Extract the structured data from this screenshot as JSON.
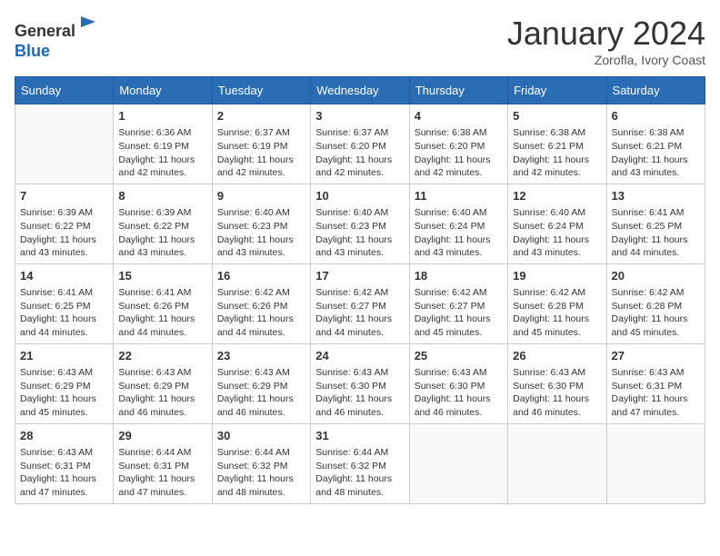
{
  "header": {
    "logo_general": "General",
    "logo_blue": "Blue",
    "month_title": "January 2024",
    "location": "Zorofla, Ivory Coast"
  },
  "days_of_week": [
    "Sunday",
    "Monday",
    "Tuesday",
    "Wednesday",
    "Thursday",
    "Friday",
    "Saturday"
  ],
  "weeks": [
    [
      {
        "day": "",
        "info": ""
      },
      {
        "day": "1",
        "info": "Sunrise: 6:36 AM\nSunset: 6:19 PM\nDaylight: 11 hours\nand 42 minutes."
      },
      {
        "day": "2",
        "info": "Sunrise: 6:37 AM\nSunset: 6:19 PM\nDaylight: 11 hours\nand 42 minutes."
      },
      {
        "day": "3",
        "info": "Sunrise: 6:37 AM\nSunset: 6:20 PM\nDaylight: 11 hours\nand 42 minutes."
      },
      {
        "day": "4",
        "info": "Sunrise: 6:38 AM\nSunset: 6:20 PM\nDaylight: 11 hours\nand 42 minutes."
      },
      {
        "day": "5",
        "info": "Sunrise: 6:38 AM\nSunset: 6:21 PM\nDaylight: 11 hours\nand 42 minutes."
      },
      {
        "day": "6",
        "info": "Sunrise: 6:38 AM\nSunset: 6:21 PM\nDaylight: 11 hours\nand 43 minutes."
      }
    ],
    [
      {
        "day": "7",
        "info": "Sunrise: 6:39 AM\nSunset: 6:22 PM\nDaylight: 11 hours\nand 43 minutes."
      },
      {
        "day": "8",
        "info": "Sunrise: 6:39 AM\nSunset: 6:22 PM\nDaylight: 11 hours\nand 43 minutes."
      },
      {
        "day": "9",
        "info": "Sunrise: 6:40 AM\nSunset: 6:23 PM\nDaylight: 11 hours\nand 43 minutes."
      },
      {
        "day": "10",
        "info": "Sunrise: 6:40 AM\nSunset: 6:23 PM\nDaylight: 11 hours\nand 43 minutes."
      },
      {
        "day": "11",
        "info": "Sunrise: 6:40 AM\nSunset: 6:24 PM\nDaylight: 11 hours\nand 43 minutes."
      },
      {
        "day": "12",
        "info": "Sunrise: 6:40 AM\nSunset: 6:24 PM\nDaylight: 11 hours\nand 43 minutes."
      },
      {
        "day": "13",
        "info": "Sunrise: 6:41 AM\nSunset: 6:25 PM\nDaylight: 11 hours\nand 44 minutes."
      }
    ],
    [
      {
        "day": "14",
        "info": "Sunrise: 6:41 AM\nSunset: 6:25 PM\nDaylight: 11 hours\nand 44 minutes."
      },
      {
        "day": "15",
        "info": "Sunrise: 6:41 AM\nSunset: 6:26 PM\nDaylight: 11 hours\nand 44 minutes."
      },
      {
        "day": "16",
        "info": "Sunrise: 6:42 AM\nSunset: 6:26 PM\nDaylight: 11 hours\nand 44 minutes."
      },
      {
        "day": "17",
        "info": "Sunrise: 6:42 AM\nSunset: 6:27 PM\nDaylight: 11 hours\nand 44 minutes."
      },
      {
        "day": "18",
        "info": "Sunrise: 6:42 AM\nSunset: 6:27 PM\nDaylight: 11 hours\nand 45 minutes."
      },
      {
        "day": "19",
        "info": "Sunrise: 6:42 AM\nSunset: 6:28 PM\nDaylight: 11 hours\nand 45 minutes."
      },
      {
        "day": "20",
        "info": "Sunrise: 6:42 AM\nSunset: 6:28 PM\nDaylight: 11 hours\nand 45 minutes."
      }
    ],
    [
      {
        "day": "21",
        "info": "Sunrise: 6:43 AM\nSunset: 6:29 PM\nDaylight: 11 hours\nand 45 minutes."
      },
      {
        "day": "22",
        "info": "Sunrise: 6:43 AM\nSunset: 6:29 PM\nDaylight: 11 hours\nand 46 minutes."
      },
      {
        "day": "23",
        "info": "Sunrise: 6:43 AM\nSunset: 6:29 PM\nDaylight: 11 hours\nand 46 minutes."
      },
      {
        "day": "24",
        "info": "Sunrise: 6:43 AM\nSunset: 6:30 PM\nDaylight: 11 hours\nand 46 minutes."
      },
      {
        "day": "25",
        "info": "Sunrise: 6:43 AM\nSunset: 6:30 PM\nDaylight: 11 hours\nand 46 minutes."
      },
      {
        "day": "26",
        "info": "Sunrise: 6:43 AM\nSunset: 6:30 PM\nDaylight: 11 hours\nand 46 minutes."
      },
      {
        "day": "27",
        "info": "Sunrise: 6:43 AM\nSunset: 6:31 PM\nDaylight: 11 hours\nand 47 minutes."
      }
    ],
    [
      {
        "day": "28",
        "info": "Sunrise: 6:43 AM\nSunset: 6:31 PM\nDaylight: 11 hours\nand 47 minutes."
      },
      {
        "day": "29",
        "info": "Sunrise: 6:44 AM\nSunset: 6:31 PM\nDaylight: 11 hours\nand 47 minutes."
      },
      {
        "day": "30",
        "info": "Sunrise: 6:44 AM\nSunset: 6:32 PM\nDaylight: 11 hours\nand 48 minutes."
      },
      {
        "day": "31",
        "info": "Sunrise: 6:44 AM\nSunset: 6:32 PM\nDaylight: 11 hours\nand 48 minutes."
      },
      {
        "day": "",
        "info": ""
      },
      {
        "day": "",
        "info": ""
      },
      {
        "day": "",
        "info": ""
      }
    ]
  ]
}
